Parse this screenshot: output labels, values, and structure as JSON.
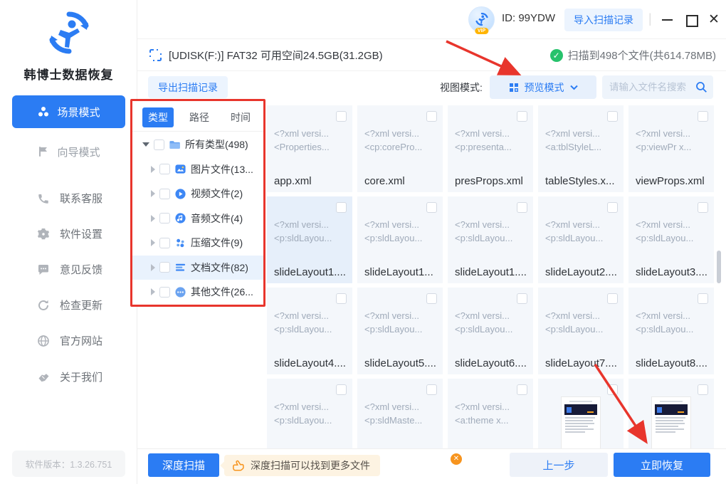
{
  "app": {
    "name": "韩博士数据恢复",
    "version": "软件版本：1.3.26.751"
  },
  "titlebar": {
    "user_id": "ID: 99YDW",
    "import_button": "导入扫描记录"
  },
  "sidebar": {
    "modes": [
      {
        "label": "场景模式",
        "icon": "scene-mode-icon",
        "active": true
      },
      {
        "label": "向导模式",
        "icon": "flag-icon",
        "active": false
      }
    ],
    "items": [
      {
        "label": "联系客服",
        "icon": "phone-icon"
      },
      {
        "label": "软件设置",
        "icon": "gear-icon"
      },
      {
        "label": "意见反馈",
        "icon": "feedback-icon"
      },
      {
        "label": "检查更新",
        "icon": "update-icon"
      },
      {
        "label": "官方网站",
        "icon": "globe-icon"
      },
      {
        "label": "关于我们",
        "icon": "about-icon"
      }
    ]
  },
  "header": {
    "drive_info": "[UDISK(F:)] FAT32 可用空间24.5GB(31.2GB)",
    "scan_status": "扫描到498个文件(共614.78MB)"
  },
  "toolbar": {
    "export_button": "导出扫描记录",
    "view_mode_label": "视图模式:",
    "view_mode_value": "预览模式",
    "search_placeholder": "请输入文件名搜索"
  },
  "tree": {
    "tabs": [
      "类型",
      "路径",
      "时间"
    ],
    "active_tab": "类型",
    "nodes": [
      {
        "label": "所有类型(498)",
        "icon": "folder-icon",
        "expanded": true
      },
      {
        "label": "图片文件(13...",
        "icon": "image-icon"
      },
      {
        "label": "视频文件(2)",
        "icon": "video-icon"
      },
      {
        "label": "音频文件(4)",
        "icon": "audio-icon"
      },
      {
        "label": "压缩文件(9)",
        "icon": "archive-icon"
      },
      {
        "label": "文档文件(82)",
        "icon": "document-icon",
        "selected": true
      },
      {
        "label": "其他文件(26...",
        "icon": "other-icon"
      }
    ]
  },
  "files": {
    "cards": [
      {
        "filename": "app.xml",
        "preview": [
          "<?xml versi...",
          "<Properties..."
        ]
      },
      {
        "filename": "core.xml",
        "preview": [
          "<?xml versi...",
          "<cp:corePro..."
        ]
      },
      {
        "filename": "presProps.xml",
        "preview": [
          "<?xml versi...",
          "<p:presenta..."
        ]
      },
      {
        "filename": "tableStyles.x...",
        "preview": [
          "<?xml versi...",
          "<a:tblStyleL..."
        ]
      },
      {
        "filename": "viewProps.xml",
        "preview": [
          "<?xml versi...",
          "<p:viewPr x..."
        ]
      },
      {
        "filename": "slideLayout1....",
        "preview": [
          "<?xml versi...",
          "<p:sldLayou..."
        ],
        "highlighted": true
      },
      {
        "filename": "slideLayout1...",
        "preview": [
          "<?xml versi...",
          "<p:sldLayou..."
        ]
      },
      {
        "filename": "slideLayout1....",
        "preview": [
          "<?xml versi...",
          "<p:sldLayou..."
        ]
      },
      {
        "filename": "slideLayout2....",
        "preview": [
          "<?xml versi...",
          "<p:sldLayou..."
        ]
      },
      {
        "filename": "slideLayout3....",
        "preview": [
          "<?xml versi...",
          "<p:sldLayou..."
        ]
      },
      {
        "filename": "slideLayout4....",
        "preview": [
          "<?xml versi...",
          "<p:sldLayou..."
        ]
      },
      {
        "filename": "slideLayout5....",
        "preview": [
          "<?xml versi...",
          "<p:sldLayou..."
        ]
      },
      {
        "filename": "slideLayout6....",
        "preview": [
          "<?xml versi...",
          "<p:sldLayou..."
        ]
      },
      {
        "filename": "slideLayout7....",
        "preview": [
          "<?xml versi...",
          "<p:sldLayou..."
        ]
      },
      {
        "filename": "slideLayout8....",
        "preview": [
          "<?xml versi...",
          "<p:sldLayou..."
        ]
      },
      {
        "filename": "",
        "preview": [
          "<?xml versi...",
          "<p:sldLayou..."
        ]
      },
      {
        "filename": "",
        "preview": [
          "<?xml versi...",
          "<p:sldMaste..."
        ]
      },
      {
        "filename": "",
        "preview": [
          "<?xml versi...",
          "<a:theme  x..."
        ]
      },
      {
        "filename": "",
        "thumb": true
      },
      {
        "filename": "",
        "thumb": true
      }
    ]
  },
  "footer": {
    "deep_scan_button": "深度扫描",
    "tip_text": "深度扫描可以找到更多文件",
    "prev_button": "上一步",
    "recover_button": "立即恢复"
  },
  "colors": {
    "primary_blue": "#2b7cf3",
    "light_blue_chip": "#ecf4fe",
    "card_bg": "#f4f7fb",
    "annotation_red": "#e8352c",
    "success_green": "#27c26c",
    "tip_orange": "#f7941e",
    "tip_bg": "#fdf3e2"
  }
}
